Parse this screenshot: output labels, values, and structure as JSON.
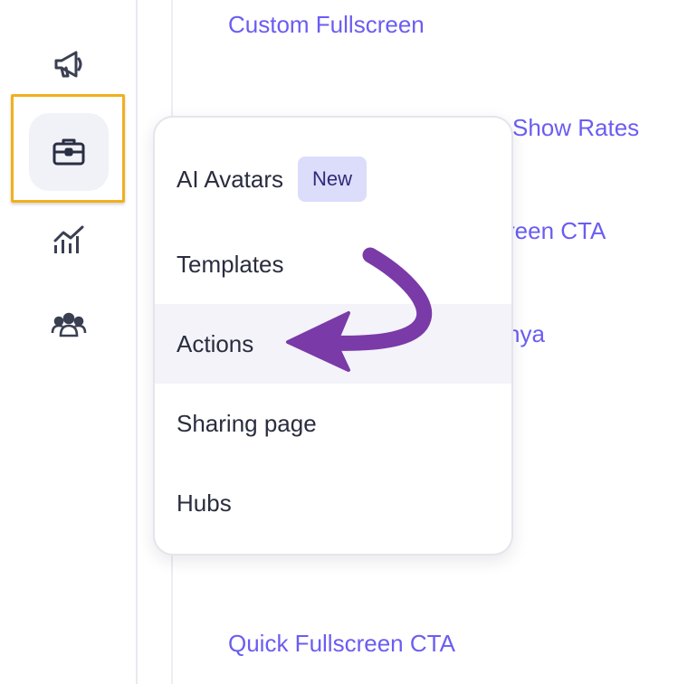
{
  "rail": {
    "items": [
      {
        "icon": "megaphone-icon"
      },
      {
        "icon": "briefcase-icon",
        "active": true
      },
      {
        "icon": "analytics-chart-icon"
      },
      {
        "icon": "team-users-icon"
      }
    ]
  },
  "content": {
    "links": [
      "Custom Fullscreen",
      "Show Rates",
      "reen CTA",
      "nya",
      "Quick Fullscreen CTA"
    ]
  },
  "menu": {
    "items": [
      {
        "label": "AI Avatars",
        "badge": "New"
      },
      {
        "label": "Templates"
      },
      {
        "label": "Actions",
        "active": true
      },
      {
        "label": "Sharing page"
      },
      {
        "label": "Hubs"
      }
    ]
  },
  "colors": {
    "accent_link": "#6a5df2",
    "highlight_box": "#f2b01e",
    "arrow": "#7a3aa8",
    "badge_bg": "#dcdcfb"
  }
}
